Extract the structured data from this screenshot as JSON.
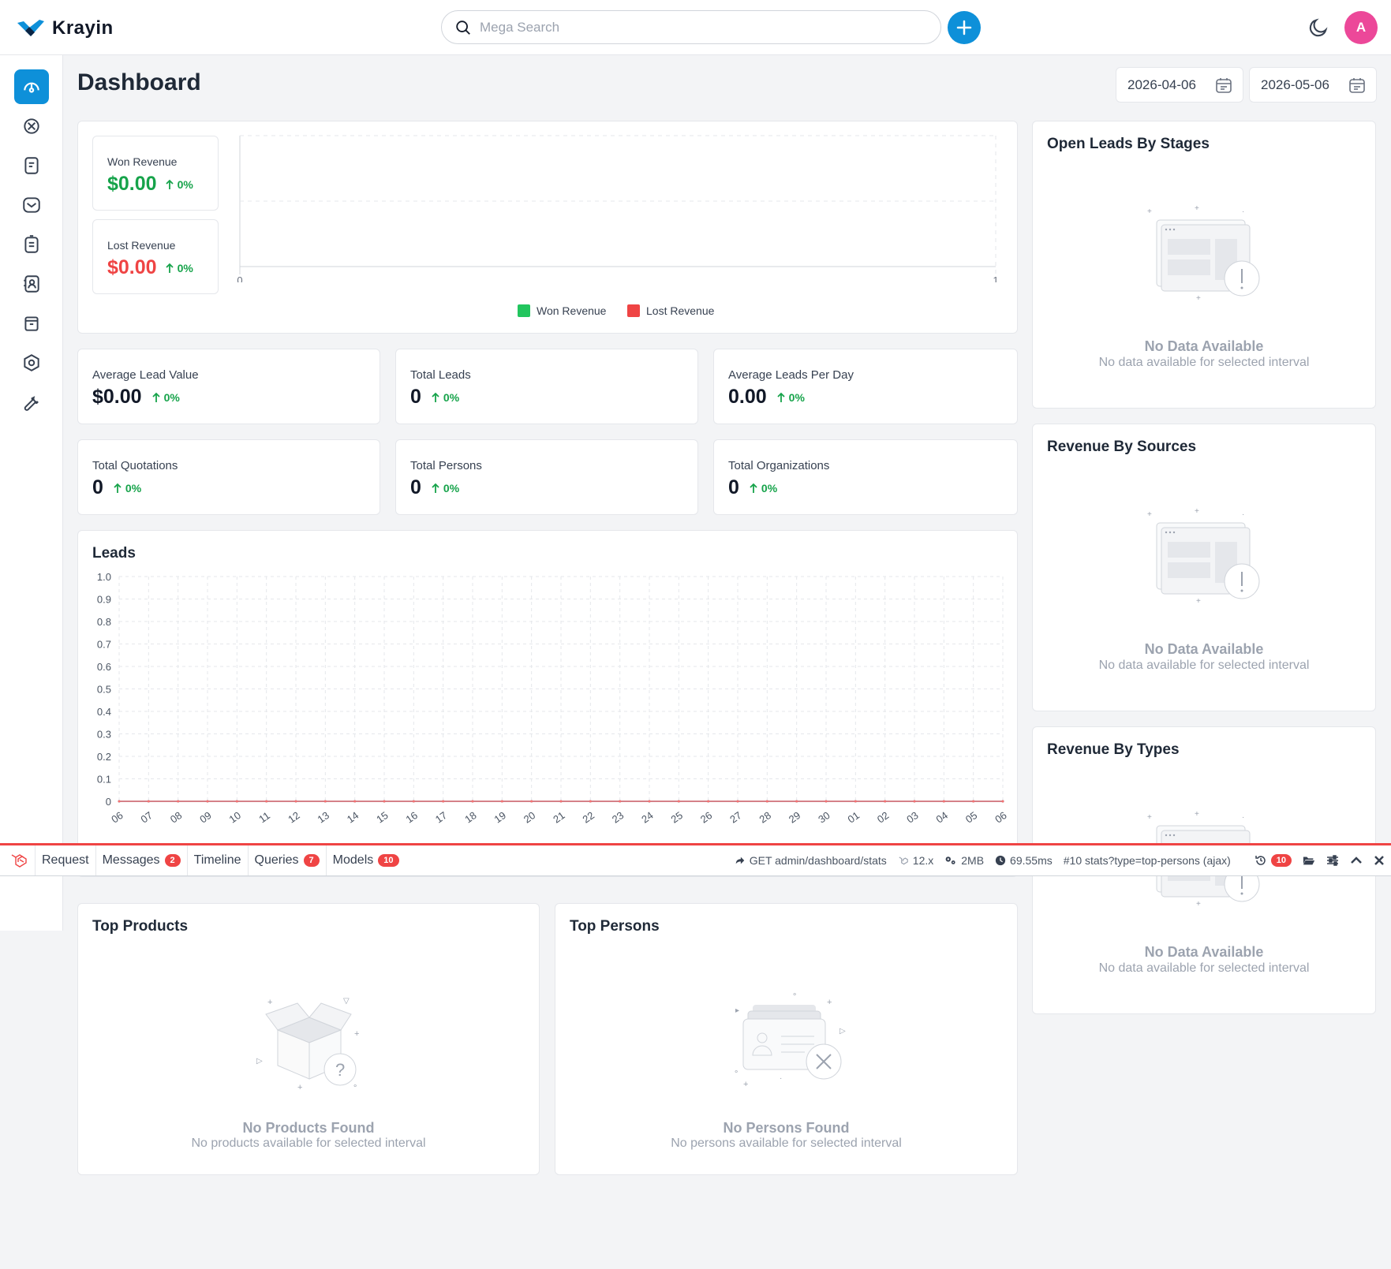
{
  "app": {
    "name": "Krayin"
  },
  "search": {
    "placeholder": "Mega Search"
  },
  "user": {
    "avatar_letter": "A"
  },
  "page": {
    "title": "Dashboard"
  },
  "date_range": {
    "start": "2026-04-06",
    "end": "2026-05-06"
  },
  "revenue": {
    "won": {
      "label": "Won Revenue",
      "value": "$0.00",
      "change": "0%"
    },
    "lost": {
      "label": "Lost Revenue",
      "value": "$0.00",
      "change": "0%"
    },
    "chart": {
      "x_min_label": "0",
      "x_max_label": "1"
    },
    "legend": [
      {
        "name": "Won Revenue",
        "color": "#22c55e"
      },
      {
        "name": "Lost Revenue",
        "color": "#ef4444"
      }
    ]
  },
  "stats": [
    {
      "label": "Average Lead Value",
      "value": "$0.00",
      "change": "0%"
    },
    {
      "label": "Total Leads",
      "value": "0",
      "change": "0%"
    },
    {
      "label": "Average Leads Per Day",
      "value": "0.00",
      "change": "0%"
    },
    {
      "label": "Total Quotations",
      "value": "0",
      "change": "0%"
    },
    {
      "label": "Total Persons",
      "value": "0",
      "change": "0%"
    },
    {
      "label": "Total Organizations",
      "value": "0",
      "change": "0%"
    }
  ],
  "leads": {
    "title": "Leads"
  },
  "right_panels": [
    {
      "title": "Open Leads By Stages",
      "empty_title": "No Data Available",
      "empty_sub": "No data available for selected interval"
    },
    {
      "title": "Revenue By Sources",
      "empty_title": "No Data Available",
      "empty_sub": "No data available for selected interval"
    },
    {
      "title": "Revenue By Types",
      "empty_title": "No Data Available",
      "empty_sub": "No data available for selected interval"
    }
  ],
  "top_products": {
    "title": "Top Products",
    "empty_title": "No Products Found",
    "empty_sub": "No products available for selected interval"
  },
  "top_persons": {
    "title": "Top Persons",
    "empty_title": "No Persons Found",
    "empty_sub": "No persons available for selected interval"
  },
  "debugbar": {
    "tabs": [
      {
        "label": "Request",
        "badge": ""
      },
      {
        "label": "Messages",
        "badge": "2"
      },
      {
        "label": "Timeline",
        "badge": ""
      },
      {
        "label": "Queries",
        "badge": "7"
      },
      {
        "label": "Models",
        "badge": "10"
      }
    ],
    "request": "GET admin/dashboard/stats",
    "version": "12.x",
    "memory": "2MB",
    "duration": "69.55ms",
    "history_select": "#10 stats?type=top-persons (ajax)",
    "history_count": "10"
  },
  "chart_data": {
    "type": "line",
    "title": "Leads",
    "ylim": [
      0,
      1.0
    ],
    "yticks": [
      "0",
      "0.1",
      "0.2",
      "0.3",
      "0.4",
      "0.5",
      "0.6",
      "0.7",
      "0.8",
      "0.9",
      "1.0"
    ],
    "categories": [
      "06",
      "07",
      "08",
      "09",
      "10",
      "11",
      "12",
      "13",
      "14",
      "15",
      "16",
      "17",
      "18",
      "19",
      "20",
      "21",
      "22",
      "23",
      "24",
      "25",
      "26",
      "27",
      "28",
      "29",
      "30",
      "01",
      "02",
      "03",
      "04",
      "05",
      "06"
    ],
    "series": [
      {
        "values": [
          0,
          0,
          0,
          0,
          0,
          0,
          0,
          0,
          0,
          0,
          0,
          0,
          0,
          0,
          0,
          0,
          0,
          0,
          0,
          0,
          0,
          0,
          0,
          0,
          0,
          0,
          0,
          0,
          0,
          0,
          0
        ],
        "color": "#8b5cf6"
      },
      {
        "values": [
          0,
          0,
          0,
          0,
          0,
          0,
          0,
          0,
          0,
          0,
          0,
          0,
          0,
          0,
          0,
          0,
          0,
          0,
          0,
          0,
          0,
          0,
          0,
          0,
          0,
          0,
          0,
          0,
          0,
          0,
          0
        ],
        "color": "#14b8a6"
      },
      {
        "values": [
          0,
          0,
          0,
          0,
          0,
          0,
          0,
          0,
          0,
          0,
          0,
          0,
          0,
          0,
          0,
          0,
          0,
          0,
          0,
          0,
          0,
          0,
          0,
          0,
          0,
          0,
          0,
          0,
          0,
          0,
          0
        ],
        "color": "#f87171"
      }
    ],
    "grid": true
  }
}
